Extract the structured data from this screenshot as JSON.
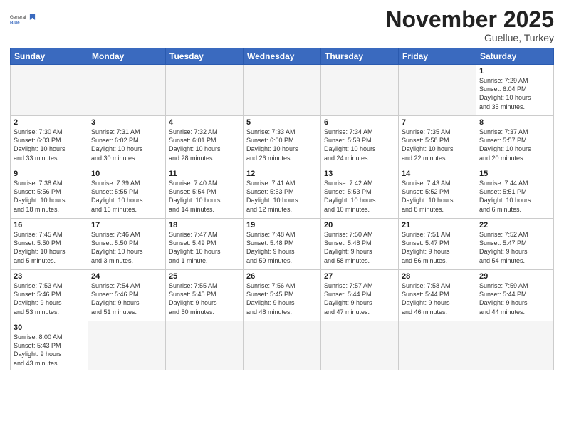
{
  "header": {
    "logo_general": "General",
    "logo_blue": "Blue",
    "month_title": "November 2025",
    "subtitle": "Guellue, Turkey"
  },
  "days_of_week": [
    "Sunday",
    "Monday",
    "Tuesday",
    "Wednesday",
    "Thursday",
    "Friday",
    "Saturday"
  ],
  "weeks": [
    [
      {
        "day": "",
        "info": ""
      },
      {
        "day": "",
        "info": ""
      },
      {
        "day": "",
        "info": ""
      },
      {
        "day": "",
        "info": ""
      },
      {
        "day": "",
        "info": ""
      },
      {
        "day": "",
        "info": ""
      },
      {
        "day": "1",
        "info": "Sunrise: 7:29 AM\nSunset: 6:04 PM\nDaylight: 10 hours\nand 35 minutes."
      }
    ],
    [
      {
        "day": "2",
        "info": "Sunrise: 7:30 AM\nSunset: 6:03 PM\nDaylight: 10 hours\nand 33 minutes."
      },
      {
        "day": "3",
        "info": "Sunrise: 7:31 AM\nSunset: 6:02 PM\nDaylight: 10 hours\nand 30 minutes."
      },
      {
        "day": "4",
        "info": "Sunrise: 7:32 AM\nSunset: 6:01 PM\nDaylight: 10 hours\nand 28 minutes."
      },
      {
        "day": "5",
        "info": "Sunrise: 7:33 AM\nSunset: 6:00 PM\nDaylight: 10 hours\nand 26 minutes."
      },
      {
        "day": "6",
        "info": "Sunrise: 7:34 AM\nSunset: 5:59 PM\nDaylight: 10 hours\nand 24 minutes."
      },
      {
        "day": "7",
        "info": "Sunrise: 7:35 AM\nSunset: 5:58 PM\nDaylight: 10 hours\nand 22 minutes."
      },
      {
        "day": "8",
        "info": "Sunrise: 7:37 AM\nSunset: 5:57 PM\nDaylight: 10 hours\nand 20 minutes."
      }
    ],
    [
      {
        "day": "9",
        "info": "Sunrise: 7:38 AM\nSunset: 5:56 PM\nDaylight: 10 hours\nand 18 minutes."
      },
      {
        "day": "10",
        "info": "Sunrise: 7:39 AM\nSunset: 5:55 PM\nDaylight: 10 hours\nand 16 minutes."
      },
      {
        "day": "11",
        "info": "Sunrise: 7:40 AM\nSunset: 5:54 PM\nDaylight: 10 hours\nand 14 minutes."
      },
      {
        "day": "12",
        "info": "Sunrise: 7:41 AM\nSunset: 5:53 PM\nDaylight: 10 hours\nand 12 minutes."
      },
      {
        "day": "13",
        "info": "Sunrise: 7:42 AM\nSunset: 5:53 PM\nDaylight: 10 hours\nand 10 minutes."
      },
      {
        "day": "14",
        "info": "Sunrise: 7:43 AM\nSunset: 5:52 PM\nDaylight: 10 hours\nand 8 minutes."
      },
      {
        "day": "15",
        "info": "Sunrise: 7:44 AM\nSunset: 5:51 PM\nDaylight: 10 hours\nand 6 minutes."
      }
    ],
    [
      {
        "day": "16",
        "info": "Sunrise: 7:45 AM\nSunset: 5:50 PM\nDaylight: 10 hours\nand 5 minutes."
      },
      {
        "day": "17",
        "info": "Sunrise: 7:46 AM\nSunset: 5:50 PM\nDaylight: 10 hours\nand 3 minutes."
      },
      {
        "day": "18",
        "info": "Sunrise: 7:47 AM\nSunset: 5:49 PM\nDaylight: 10 hours\nand 1 minute."
      },
      {
        "day": "19",
        "info": "Sunrise: 7:48 AM\nSunset: 5:48 PM\nDaylight: 9 hours\nand 59 minutes."
      },
      {
        "day": "20",
        "info": "Sunrise: 7:50 AM\nSunset: 5:48 PM\nDaylight: 9 hours\nand 58 minutes."
      },
      {
        "day": "21",
        "info": "Sunrise: 7:51 AM\nSunset: 5:47 PM\nDaylight: 9 hours\nand 56 minutes."
      },
      {
        "day": "22",
        "info": "Sunrise: 7:52 AM\nSunset: 5:47 PM\nDaylight: 9 hours\nand 54 minutes."
      }
    ],
    [
      {
        "day": "23",
        "info": "Sunrise: 7:53 AM\nSunset: 5:46 PM\nDaylight: 9 hours\nand 53 minutes."
      },
      {
        "day": "24",
        "info": "Sunrise: 7:54 AM\nSunset: 5:46 PM\nDaylight: 9 hours\nand 51 minutes."
      },
      {
        "day": "25",
        "info": "Sunrise: 7:55 AM\nSunset: 5:45 PM\nDaylight: 9 hours\nand 50 minutes."
      },
      {
        "day": "26",
        "info": "Sunrise: 7:56 AM\nSunset: 5:45 PM\nDaylight: 9 hours\nand 48 minutes."
      },
      {
        "day": "27",
        "info": "Sunrise: 7:57 AM\nSunset: 5:44 PM\nDaylight: 9 hours\nand 47 minutes."
      },
      {
        "day": "28",
        "info": "Sunrise: 7:58 AM\nSunset: 5:44 PM\nDaylight: 9 hours\nand 46 minutes."
      },
      {
        "day": "29",
        "info": "Sunrise: 7:59 AM\nSunset: 5:44 PM\nDaylight: 9 hours\nand 44 minutes."
      }
    ],
    [
      {
        "day": "30",
        "info": "Sunrise: 8:00 AM\nSunset: 5:43 PM\nDaylight: 9 hours\nand 43 minutes."
      },
      {
        "day": "",
        "info": ""
      },
      {
        "day": "",
        "info": ""
      },
      {
        "day": "",
        "info": ""
      },
      {
        "day": "",
        "info": ""
      },
      {
        "day": "",
        "info": ""
      },
      {
        "day": "",
        "info": ""
      }
    ]
  ]
}
